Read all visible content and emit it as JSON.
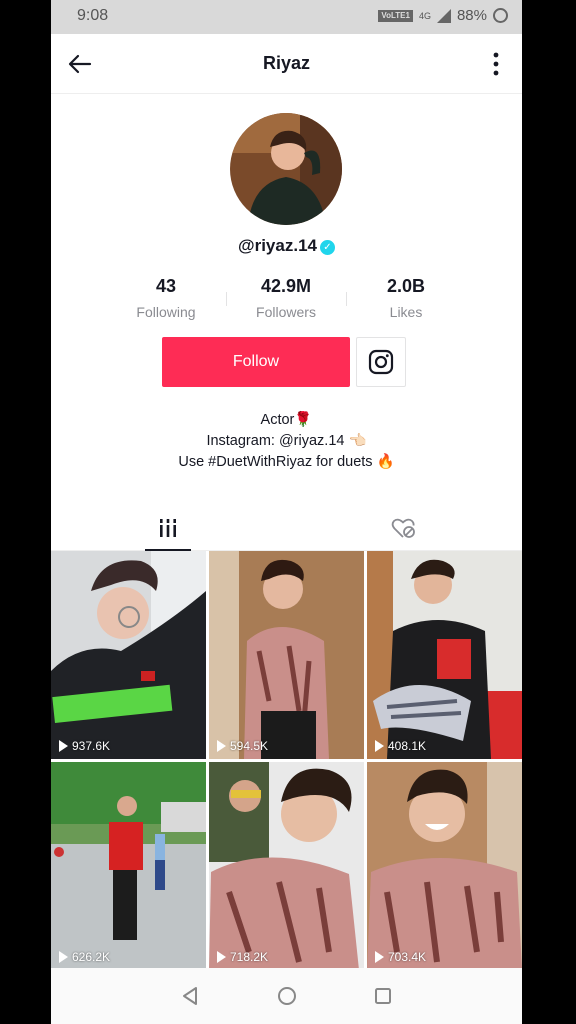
{
  "status_bar": {
    "time": "9:08",
    "network_badge": "VoLTE1",
    "network_type": "4G",
    "battery": "88%"
  },
  "header": {
    "title": "Riyaz",
    "back_icon": "arrow-left-icon",
    "menu_icon": "more-vertical-icon"
  },
  "profile": {
    "username": "@riyaz.14",
    "verified": true,
    "stats": [
      {
        "value": "43",
        "label": "Following"
      },
      {
        "value": "42.9M",
        "label": "Followers"
      },
      {
        "value": "2.0B",
        "label": "Likes"
      }
    ],
    "follow_label": "Follow",
    "bio": [
      "Actor🌹",
      "Instagram: @riyaz.14 👈🏻",
      "Use #DuetWithRiyaz for duets 🔥"
    ]
  },
  "tabs": [
    {
      "name": "videos",
      "icon": "grid-icon",
      "active": true
    },
    {
      "name": "liked",
      "icon": "liked-hidden-icon",
      "active": false
    }
  ],
  "videos": [
    {
      "views": "937.6K"
    },
    {
      "views": "594.5K"
    },
    {
      "views": "408.1K"
    },
    {
      "views": "626.2K"
    },
    {
      "views": "718.2K"
    },
    {
      "views": "703.4K"
    }
  ],
  "colors": {
    "accent": "#fe2c55",
    "verified": "#20d5ec",
    "text": "#161823",
    "muted": "#8a8b91"
  }
}
